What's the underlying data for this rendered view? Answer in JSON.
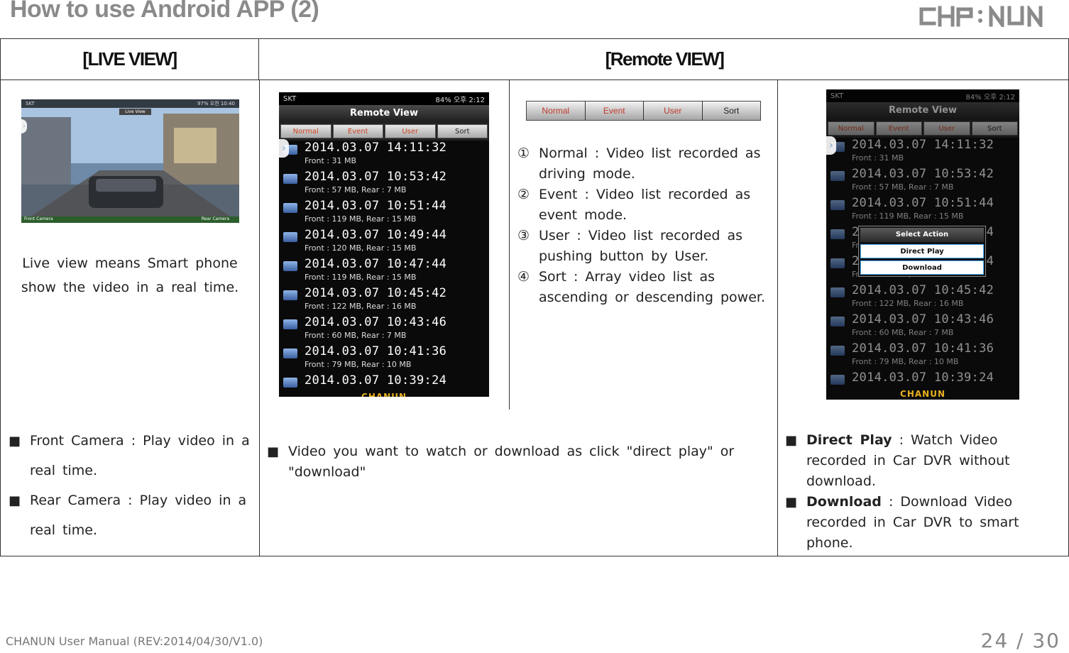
{
  "page": {
    "title": "How to use Android APP (2)",
    "brand": "CHANUN",
    "footer_left": "CHANUN User Manual (REV:2014/04/30/V1.0)",
    "footer_page": "24 / 30"
  },
  "headers": {
    "live": "[LIVE VIEW]",
    "remote": "[Remote VIEW]"
  },
  "live_view": {
    "screen": {
      "status_left": "SKT",
      "status_right": "97% 오전 10:40",
      "title": "Live View",
      "front_label": "Front Camera",
      "rear_label": "Rear Camera"
    },
    "description": "Live view means Smart phone show the video in a real time.",
    "bullets": [
      "Front Camera : Play video in a real time.",
      "Rear Camera : Play video in a real time."
    ]
  },
  "remote_screen": {
    "status_left": "SKT",
    "status_right": "84% 오후 2:12",
    "title": "Remote View",
    "tabs": [
      "Normal",
      "Event",
      "User",
      "Sort"
    ],
    "records": [
      {
        "datetime": "2014.03.07  14:11:32",
        "info": "Front : 31 MB"
      },
      {
        "datetime": "2014.03.07  10:53:42",
        "info": "Front : 57 MB, Rear : 7 MB"
      },
      {
        "datetime": "2014.03.07  10:51:44",
        "info": "Front : 119 MB, Rear : 15 MB"
      },
      {
        "datetime": "2014.03.07  10:49:44",
        "info": "Front : 120 MB, Rear : 15 MB"
      },
      {
        "datetime": "2014.03.07  10:47:44",
        "info": "Front : 119 MB, Rear : 15 MB"
      },
      {
        "datetime": "2014.03.07  10:45:42",
        "info": "Front : 122 MB, Rear : 16 MB"
      },
      {
        "datetime": "2014.03.07  10:43:46",
        "info": "Front : 60 MB, Rear : 7 MB"
      },
      {
        "datetime": "2014.03.07  10:41:36",
        "info": "Front : 79 MB, Rear : 10 MB"
      },
      {
        "datetime": "2014.03.07  10:39:24",
        "info": ""
      }
    ],
    "brand": "CHANUN"
  },
  "popup": {
    "title": "Select Action",
    "direct_play": "Direct Play",
    "download": "Download"
  },
  "tab_legend": {
    "tabs": [
      "Normal",
      "Event",
      "User",
      "Sort"
    ],
    "items": [
      {
        "num": "①",
        "text": "Normal : Video list recorded as driving mode."
      },
      {
        "num": "②",
        "text": "Event : Video list recorded as event mode."
      },
      {
        "num": "③",
        "text": "User : Video list recorded as pushing button by User."
      },
      {
        "num": "④",
        "text": "Sort : Array video list as ascending or descending power."
      }
    ]
  },
  "remote_bullet": "Video you want to watch or download as  click \"direct play\" or \"download\"",
  "action_bullets": [
    {
      "keyword": "Direct Play",
      "text": " : Watch Video recorded in  Car DVR without download."
    },
    {
      "keyword": "Download",
      "text": " : Download Video recorded in Car DVR to smart phone."
    }
  ],
  "colors": {
    "title_gray": "#8a8a8a",
    "tab_red": "#c0392b",
    "screen_bg": "#0a0a0a"
  }
}
